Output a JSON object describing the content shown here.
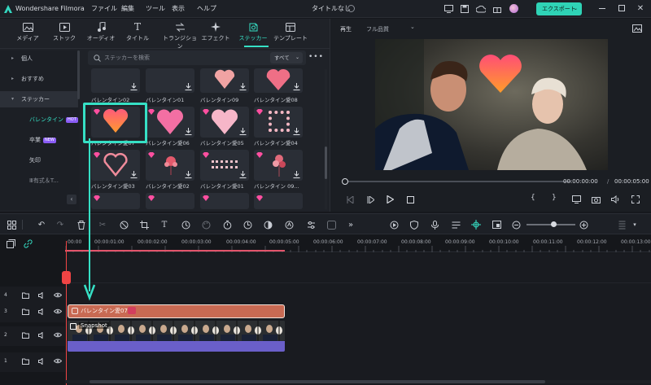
{
  "app": {
    "name": "Wondershare Filmora",
    "doc_title": "タイトルなし"
  },
  "menu": [
    "ファイル",
    "編集",
    "ツール",
    "表示",
    "ヘルプ"
  ],
  "export_label": "エクスポート",
  "tabs": [
    {
      "label": "メディア",
      "icon": "media-icon"
    },
    {
      "label": "ストック",
      "icon": "stock-icon"
    },
    {
      "label": "オーディオ",
      "icon": "music-icon"
    },
    {
      "label": "タイトル",
      "icon": "title-icon"
    },
    {
      "label": "トランジション",
      "icon": "transition-icon"
    },
    {
      "label": "エフェクト",
      "icon": "effect-icon"
    },
    {
      "label": "ステッカー",
      "icon": "sticker-icon"
    },
    {
      "label": "テンプレート",
      "icon": "template-icon"
    }
  ],
  "sidebar": {
    "items": [
      "個人",
      "おすすめ",
      "ステッカー"
    ],
    "sub": [
      "バレンタイン",
      "卒業",
      "矢印",
      "Ⅲ有式＆T..."
    ],
    "badges": [
      "HOT",
      "NEW"
    ]
  },
  "search": {
    "placeholder": "ステッカーを検索",
    "filter": "すべて"
  },
  "grid": {
    "row0": [
      "バレンタイン02",
      "バレンタイン01",
      "バレンタイン09",
      "バレンタイン愛08"
    ],
    "row1": [
      "バレンタイン愛07",
      "バレンタイン愛06",
      "バレンタイン愛05",
      "バレンタイン愛04"
    ],
    "row2": [
      "バレンタイン愛03",
      "バレンタイン愛02",
      "バレンタイン愛01",
      "バレンタイン 09..."
    ]
  },
  "preview": {
    "play_label": "再生",
    "quality": "フル品質",
    "current_time": "00:00:00:00",
    "sep": "/",
    "total_time": "00:00:05:00"
  },
  "ruler": [
    "00:00",
    "00:00:01:00",
    "00:00:02:00",
    "00:00:03:00",
    "00:00:04:00",
    "00:00:05:00",
    "00:00:06:00",
    "00:00:07:00",
    "00:00:08:00",
    "00:00:09:00",
    "00:00:10:00",
    "00:00:11:00",
    "00:00:12:00",
    "00:00:13:00"
  ],
  "tracks": [
    {
      "num": "4"
    },
    {
      "num": "3",
      "clip": "バレンタイン愛07"
    },
    {
      "num": "2",
      "clip": "Snapshot"
    },
    {
      "num": "1"
    }
  ],
  "colors": {
    "accent": "#36e0c5",
    "sticker_clip": "#c86a53",
    "video_clip": "#3c4452",
    "audio": "#6a5fc9",
    "playhead": "#ef4444"
  }
}
